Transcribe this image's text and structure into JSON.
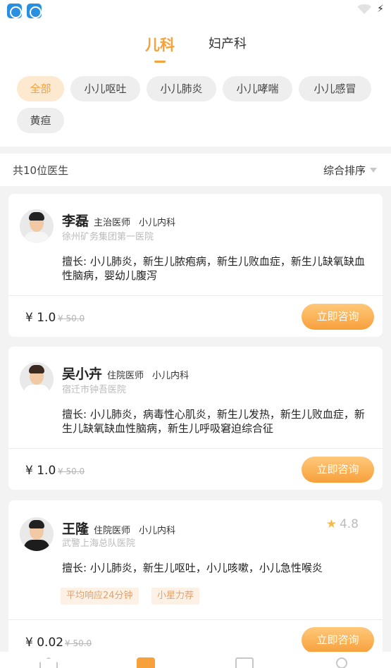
{
  "tabs": [
    "儿科",
    "妇产科"
  ],
  "chips": [
    "全部",
    "小儿呕吐",
    "小儿肺炎",
    "小儿哮喘",
    "小儿感冒",
    "黄疸"
  ],
  "summary": {
    "count_text": "共10位医生",
    "sort_label": "综合排序"
  },
  "doctors": [
    {
      "name": "李磊",
      "title": "主治医师",
      "dept": "小儿内科",
      "hospital": "徐州矿务集团第一医院",
      "specialty": "擅长: 小儿肺炎，新生儿脓疱病，新生儿败血症，新生儿缺氧缺血性脑病，婴幼儿腹泻",
      "price": "¥ 1.0",
      "original_price": "¥ 50.0",
      "button": "立即咨询"
    },
    {
      "name": "吴小卉",
      "title": "住院医师",
      "dept": "小儿内科",
      "hospital": "宿迁市钟吾医院",
      "specialty": "擅长: 小儿肺炎，病毒性心肌炎，新生儿发热，新生儿败血症，新生儿缺氧缺血性脑病，新生儿呼吸窘迫综合征",
      "price": "¥ 1.0",
      "original_price": "¥ 50.0",
      "button": "立即咨询"
    },
    {
      "name": "王隆",
      "title": "住院医师",
      "dept": "小儿内科",
      "hospital": "武警上海总队医院",
      "rating": "4.8",
      "specialty": "擅长: 小儿肺炎，新生儿呕吐，小儿咳嗽，小儿急性喉炎",
      "tags": [
        "平均响应24分钟",
        "小星力荐"
      ],
      "price": "¥ 0.02",
      "original_price": "¥ 50.0",
      "button": "立即咨询"
    }
  ],
  "colors": {
    "accent": "#f6a13b",
    "chip_active_bg": "#fde8d0",
    "page_bg": "#f3f3f3"
  },
  "icons": [
    "app-icon",
    "wifi-icon",
    "charging-icon",
    "star-icon",
    "home-icon",
    "doctor-icon",
    "message-icon",
    "profile-icon"
  ]
}
